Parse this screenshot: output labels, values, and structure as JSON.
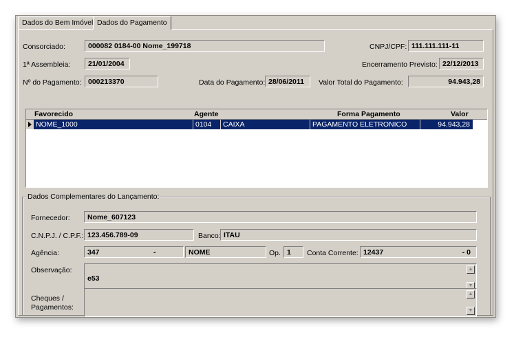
{
  "tabs": [
    {
      "label": "Dados do Bem Imóvel",
      "active": false
    },
    {
      "label": "Dados do Pagamento",
      "active": true
    }
  ],
  "header": {
    "consorciado_label": "Consorciado:",
    "consorciado_value": "000082 0184-00  Nome_199718",
    "cnpj_label": "CNPJ/CPF:",
    "cnpj_value": "111.111.111-11",
    "assembleia_label": "1ª Assembleia:",
    "assembleia_value": "21/01/2004",
    "encerramento_label": "Encerramento Previsto:",
    "encerramento_value": "22/12/2013",
    "numero_label": "Nº do Pagamento:",
    "numero_value": "000213370",
    "data_label": "Data do Pagamento:",
    "data_value": "28/06/2011",
    "valor_label": "Valor Total do Pagamento:",
    "valor_value": "94.943,28"
  },
  "grid": {
    "columns": [
      "Favorecido",
      "Agente",
      "Forma Pagamento",
      "Valor"
    ],
    "rows": [
      {
        "favorecido": "NOME_1000",
        "agente_cod": "0104",
        "agente_nome": "CAIXA",
        "forma": "PAGAMENTO ELETRONICO",
        "valor": "94.943,28"
      }
    ]
  },
  "complementares": {
    "title": "Dados Complementares do Lançamento:",
    "fornecedor_label": "Fornecedor:",
    "fornecedor_value": "Nome_607123",
    "cnpj_label": "C.N.P.J. / C.P.F.:",
    "cnpj_value": "123.456.789-09",
    "banco_label": "Banco:",
    "banco_value": "ITAU",
    "agencia_label": "Agência:",
    "agencia_value": "347",
    "agencia_digito": "-",
    "agencia_nome": "NOME",
    "op_label": "Op.",
    "op_value": "1",
    "conta_label": "Conta Corrente:",
    "conta_value": "12437",
    "conta_digito": "- 0",
    "observacao_label": "Observação:",
    "observacao_value": "e53",
    "cheques_label_1": "Cheques /",
    "cheques_label_2": "Pagamentos:",
    "cheques_value": ""
  },
  "icons": {
    "scroll_up": "scroll-up-icon",
    "scroll_down": "scroll-down-icon",
    "row_pointer": "row-pointer-icon"
  },
  "colors": {
    "selection": "#0a246a",
    "face": "#d4d0c8"
  }
}
